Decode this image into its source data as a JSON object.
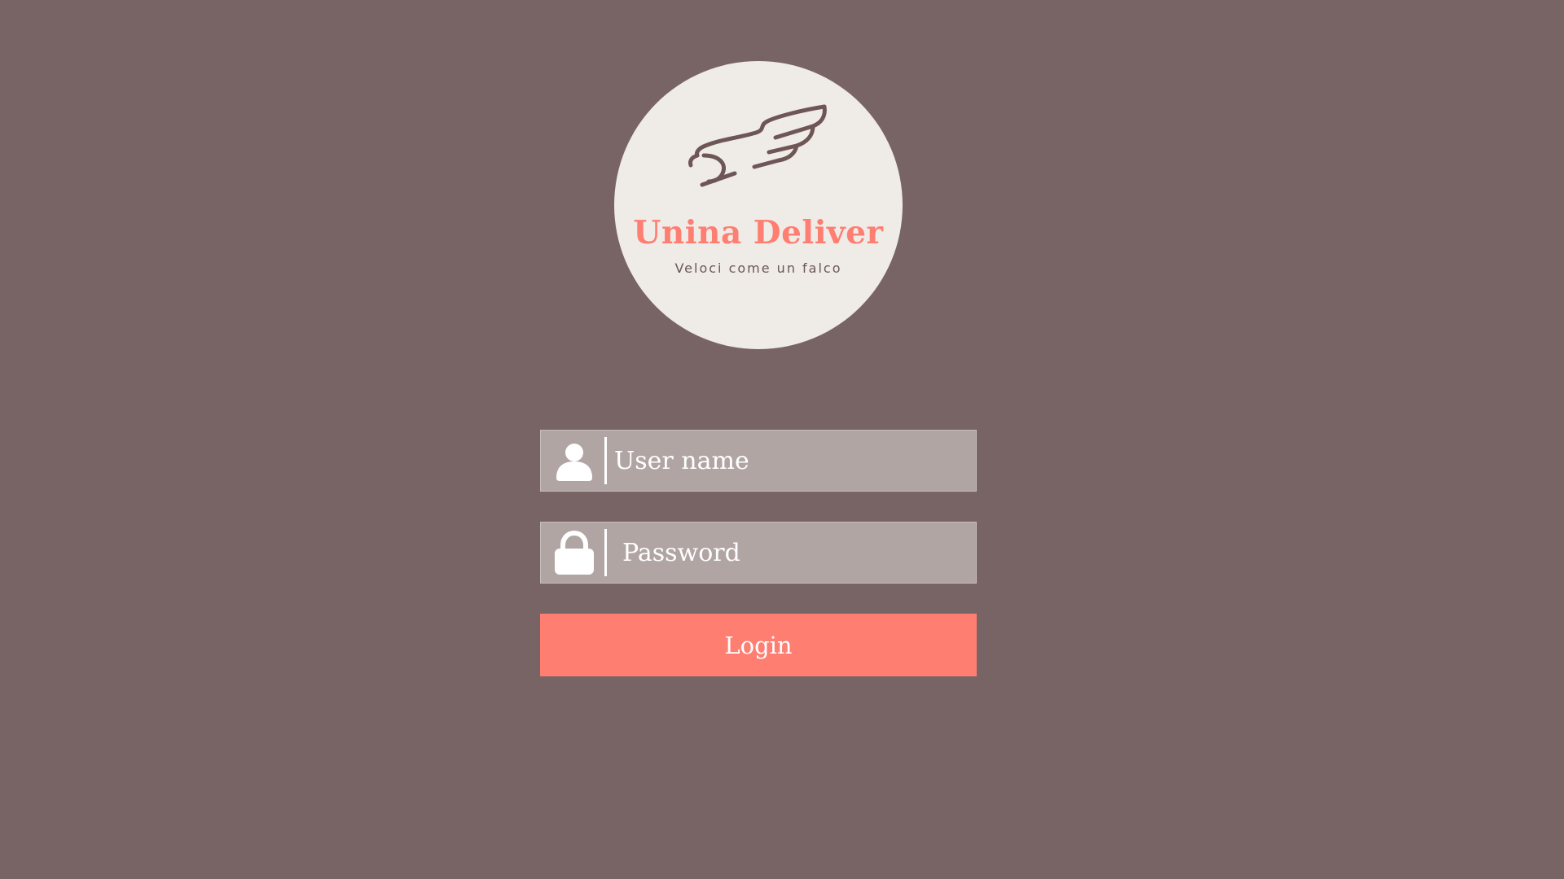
{
  "logo": {
    "brand_name": "Unina Deliver",
    "tagline": "Veloci come un falco",
    "icon": "wing-icon"
  },
  "login_form": {
    "username": {
      "icon": "user-icon",
      "placeholder": "User name",
      "value": ""
    },
    "password": {
      "icon": "lock-icon",
      "placeholder": "Password",
      "value": ""
    },
    "login_label": "Login"
  },
  "colors": {
    "background": "#786464",
    "logo_circle": "#efebe6",
    "accent": "#ff7e72",
    "field_background": "#b1a5a4",
    "text_light": "#ffffff"
  }
}
